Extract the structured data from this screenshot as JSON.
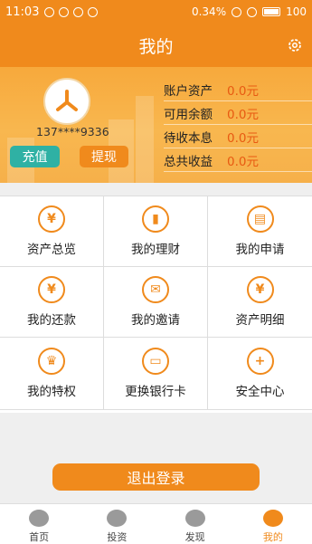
{
  "status_bar": {
    "time": "11:03",
    "speed": "0.34%",
    "battery": "100"
  },
  "header": {
    "title": "我的",
    "settings_icon": "gear-icon"
  },
  "profile": {
    "phone": "137****9336",
    "recharge_label": "充值",
    "withdraw_label": "提现",
    "stats": [
      {
        "label": "账户资产",
        "value": "0.0元"
      },
      {
        "label": "可用余额",
        "value": "0.0元"
      },
      {
        "label": "待收本息",
        "value": "0.0元"
      },
      {
        "label": "总共收益",
        "value": "0.0元"
      }
    ]
  },
  "menu": [
    {
      "label": "资产总览",
      "icon": "yen-icon",
      "glyph": "¥"
    },
    {
      "label": "我的理财",
      "icon": "chart-icon",
      "glyph": "▮"
    },
    {
      "label": "我的申请",
      "icon": "clipboard-icon",
      "glyph": "▤"
    },
    {
      "label": "我的还款",
      "icon": "repay-icon",
      "glyph": "¥"
    },
    {
      "label": "我的邀请",
      "icon": "invite-icon",
      "glyph": "✉"
    },
    {
      "label": "资产明细",
      "icon": "detail-icon",
      "glyph": "¥"
    },
    {
      "label": "我的特权",
      "icon": "crown-icon",
      "glyph": "♛"
    },
    {
      "label": "更换银行卡",
      "icon": "card-icon",
      "glyph": "▭"
    },
    {
      "label": "安全中心",
      "icon": "shield-icon",
      "glyph": "+"
    }
  ],
  "logout_label": "退出登录",
  "tabs": [
    {
      "label": "首页",
      "icon": "home-icon",
      "active": false
    },
    {
      "label": "投资",
      "icon": "invest-icon",
      "active": false
    },
    {
      "label": "发现",
      "icon": "discover-icon",
      "active": false
    },
    {
      "label": "我的",
      "icon": "profile-icon",
      "active": true
    }
  ],
  "colors": {
    "accent": "#f08a1c",
    "teal": "#2fb1a4",
    "value_red": "#e85a12"
  }
}
